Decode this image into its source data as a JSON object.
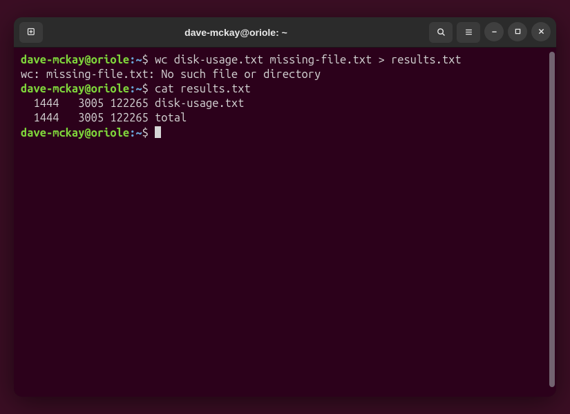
{
  "titlebar": {
    "title": "dave-mckay@oriole: ~"
  },
  "prompt": {
    "userhost": "dave-mckay@oriole",
    "sep": ":",
    "path": "~",
    "dollar": "$"
  },
  "lines": [
    {
      "type": "cmd",
      "text": "wc disk-usage.txt missing-file.txt > results.txt"
    },
    {
      "type": "out",
      "text": "wc: missing-file.txt: No such file or directory"
    },
    {
      "type": "cmd",
      "text": "cat results.txt"
    },
    {
      "type": "out",
      "text": "  1444   3005 122265 disk-usage.txt"
    },
    {
      "type": "out",
      "text": "  1444   3005 122265 total"
    },
    {
      "type": "cmd",
      "text": "",
      "cursor": true
    }
  ]
}
